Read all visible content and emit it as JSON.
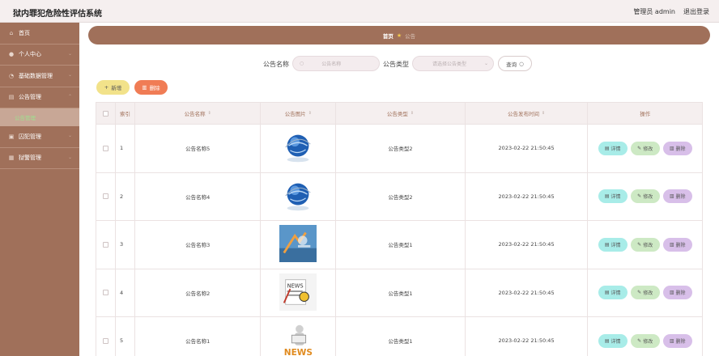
{
  "header": {
    "title": "狱内罪犯危险性评估系统",
    "admin": "管理员 admin",
    "logout": "退出登录"
  },
  "sidebar": {
    "items": [
      {
        "label": "首页",
        "icon": "home-icon"
      },
      {
        "label": "个人中心",
        "icon": "user-icon"
      },
      {
        "label": "基础数据管理",
        "icon": "database-icon"
      },
      {
        "label": "公告管理",
        "icon": "notice-icon"
      },
      {
        "label": "囚犯管理",
        "icon": "prisoner-icon"
      },
      {
        "label": "狱警管理",
        "icon": "guard-icon"
      }
    ],
    "submenu": {
      "label": "公告管理"
    }
  },
  "breadcrumb": {
    "home": "首页",
    "current": "公告"
  },
  "search": {
    "name_label": "公告名称",
    "name_placeholder": "公告名称",
    "type_label": "公告类型",
    "type_placeholder": "请选择公告类型",
    "query_button": "查询"
  },
  "actions": {
    "add": "新增",
    "delete": "删除"
  },
  "table": {
    "headers": [
      "索引",
      "公告名称",
      "公告图片",
      "公告类型",
      "公告发布时间",
      "操作"
    ],
    "rows": [
      {
        "index": "1",
        "name": "公告名称5",
        "type": "公告类型2",
        "time": "2023-02-22 21:50:45",
        "image": "globe"
      },
      {
        "index": "2",
        "name": "公告名称4",
        "type": "公告类型2",
        "time": "2023-02-22 21:50:45",
        "image": "globe"
      },
      {
        "index": "3",
        "name": "公告名称3",
        "type": "公告类型1",
        "time": "2023-02-22 21:50:45",
        "image": "news-blue"
      },
      {
        "index": "4",
        "name": "公告名称2",
        "type": "公告类型1",
        "time": "2023-02-22 21:50:45",
        "image": "news-paper"
      },
      {
        "index": "5",
        "name": "公告名称1",
        "type": "公告类型1",
        "time": "2023-02-22 21:50:45",
        "image": "news-man"
      }
    ],
    "ops": {
      "detail": "详情",
      "edit": "修改",
      "delete": "删除"
    }
  }
}
